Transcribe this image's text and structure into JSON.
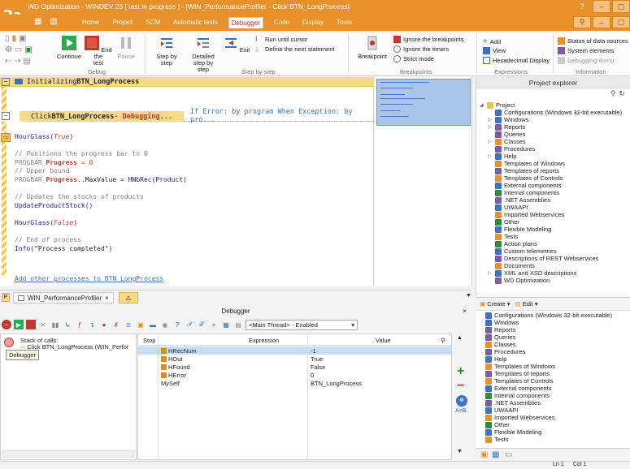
{
  "window": {
    "title": "WD Optimization - WINDEV 23 [ test in progress ] - [WIN_PerformanceProfiler - Click BTN_LongProcess]"
  },
  "menu": {
    "tabs": [
      "Home",
      "Project",
      "SCM",
      "Automatic tests",
      "Debugger",
      "Code",
      "Display",
      "Tools"
    ],
    "active": "Debugger"
  },
  "ribbon": {
    "continue": "Continue",
    "end_test_1": "End the",
    "end_test_2": "test",
    "pause": "Pause",
    "debug_group": "Debug",
    "step_by_step_1": "Step by",
    "step_by_step_2": "step",
    "detailed_1": "Detailed",
    "detailed_2": "step by step",
    "exit": "Exit",
    "run_until_cursor": "Run until cursor",
    "define_next": "Define the next statement",
    "step_group": "Step by step",
    "breakpoint": "Breakpoint",
    "ignore_breakpoints": "Ignore the breakpoints",
    "ignore_timers": "Ignore the timers",
    "strict_mode": "Strict mode",
    "breakpoints_group": "Breakpoints",
    "add": "Add",
    "view": "View",
    "hex_display": "Hexadecimal Display",
    "expressions_group": "Expressions",
    "status_data_sources": "Status of data sources",
    "system_elements": "System elements",
    "debugging_dump": "Debugging dump",
    "information_group": "Information"
  },
  "editor": {
    "init_label_prefix": "Initializing ",
    "init_label_name": "BTN_LongProcess",
    "click_prefix": "Click ",
    "click_name": "BTN_LongProcess",
    "click_debugging": " - Debugging...",
    "click_rest": "If Error: by program  When Exception: by pro...",
    "lines": {
      "l1_fn": "HourGlass(",
      "l1_arg": "True",
      "l1_end": ")",
      "l2": "// Positions the progress bar to 0",
      "l3_a": "PROGBAR_",
      "l3_b": "Progress",
      "l3_c": " = 0",
      "l4": "// Upper bound",
      "l5_a": "PROGBAR_",
      "l5_b": "Progress",
      "l5_c": "..MaxValue = ",
      "l5_d": "HNbRec(Product)",
      "l6": "// Updates the stocks of products",
      "l7": "UpdateProductStock()",
      "l8_fn": "HourGlass(",
      "l8_arg": "False",
      "l8_end": ")",
      "l9": "// End of process",
      "l10_fn": "Info(",
      "l10_str": "\"Process completed\"",
      "l10_end": ")"
    },
    "add_link": "Add other processes to BTN_LongProcess"
  },
  "project_explorer": {
    "title": "Project explorer",
    "root": "Project",
    "items": [
      "Configurations (Windows 32-bit executable)",
      "Windows",
      "Reports",
      "Queries",
      "Classes",
      "Procedures",
      "Help",
      "Templates of Windows",
      "Templates of reports",
      "Templates of Controls",
      "External components",
      "Internal components",
      ".NET Assemblies",
      "UWAAPI",
      "Imported Webservices",
      "Other",
      "Flexible Modeling",
      "Tests",
      "Action plans",
      "Custom telemetries",
      "Descriptions of REST Webservices",
      "Documents",
      "XML and XSD descriptions",
      "WD Optimization"
    ]
  },
  "dock": {
    "doc_tab": "WIN_PerformanceProfiler",
    "debugger_title": "Debugger",
    "thread": "<Main Thread> - Enabled",
    "stack_label": "Stack of calls:",
    "stack_item": "Click BTN_LongProcess (WIN_Perfor",
    "tooltip": "Debugger",
    "columns": {
      "stop": "Stop",
      "expression": "Expression",
      "value": "Value"
    },
    "rows": [
      {
        "expr": "HRecNum",
        "value": "-1"
      },
      {
        "expr": "HOut",
        "value": "True"
      },
      {
        "expr": "HFound",
        "value": "False"
      },
      {
        "expr": "HError",
        "value": "0"
      },
      {
        "expr": "MySelf",
        "value": "BTN_LongProcess"
      }
    ],
    "aeb": "A=B"
  },
  "right_bottom": {
    "create": "Create",
    "edit": "Edit",
    "items": [
      "Configurations (Windows 32-bit executable)",
      "Windows",
      "Reports",
      "Queries",
      "Classes",
      "Procedures",
      "Help",
      "Templates of Windows",
      "Templates of reports",
      "Templates of Controls",
      "External components",
      "Internal components",
      ".NET Assemblies",
      "UWAAPI",
      "Imported Webservices",
      "Other",
      "Flexible Modeling",
      "Tests"
    ]
  },
  "status": {
    "line": "Ln 1",
    "col": "Col 1"
  },
  "colors": {
    "accent": "#e8912a",
    "band": "#f6d98a",
    "selection": "#c8ddf5"
  }
}
